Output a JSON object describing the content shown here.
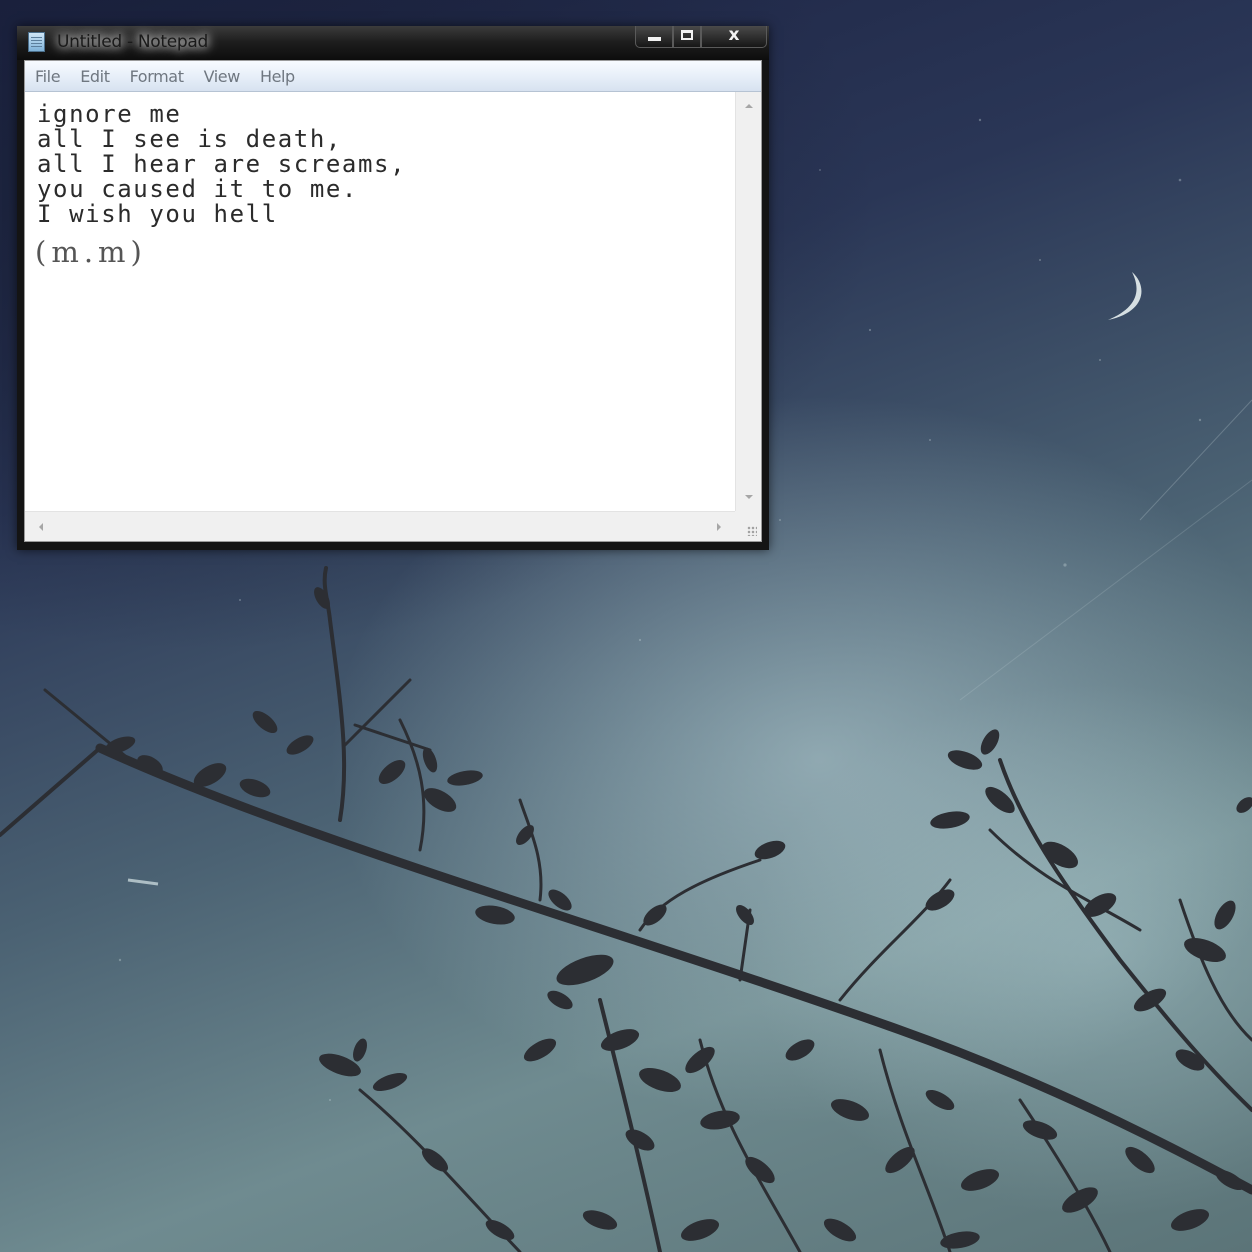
{
  "window": {
    "title": "Untitled - Notepad",
    "app_icon": "notepad-icon",
    "controls": {
      "minimize_icon": "minimize-icon",
      "maximize_icon": "maximize-icon",
      "close_label": "x"
    }
  },
  "menubar": {
    "items": [
      {
        "label": "File"
      },
      {
        "label": "Edit"
      },
      {
        "label": "Format"
      },
      {
        "label": "View"
      },
      {
        "label": "Help"
      }
    ]
  },
  "document": {
    "text": "ignore me\nall I see is death,\nall I hear are screams,\nyou caused it to me.\nI wish you hell",
    "signature": "(m.m)"
  },
  "scrollbars": {
    "vertical": {
      "up_icon": "chevron-up-icon",
      "down_icon": "chevron-down-icon"
    },
    "horizontal": {
      "left_icon": "chevron-left-icon",
      "right_icon": "chevron-right-icon"
    }
  },
  "wallpaper": {
    "description_icon": "night-sky-branches",
    "sky_color_dark": "#1a2040",
    "sky_color_light": "#7c989c",
    "branch_color": "#2c2e33",
    "moon_color": "#e8f0f0"
  },
  "theme": {
    "titlebar_color": "#141414",
    "menubar_color": "#e6eef8",
    "menu_text_color": "#6f7780",
    "editor_text_color": "#2b2b2b"
  }
}
